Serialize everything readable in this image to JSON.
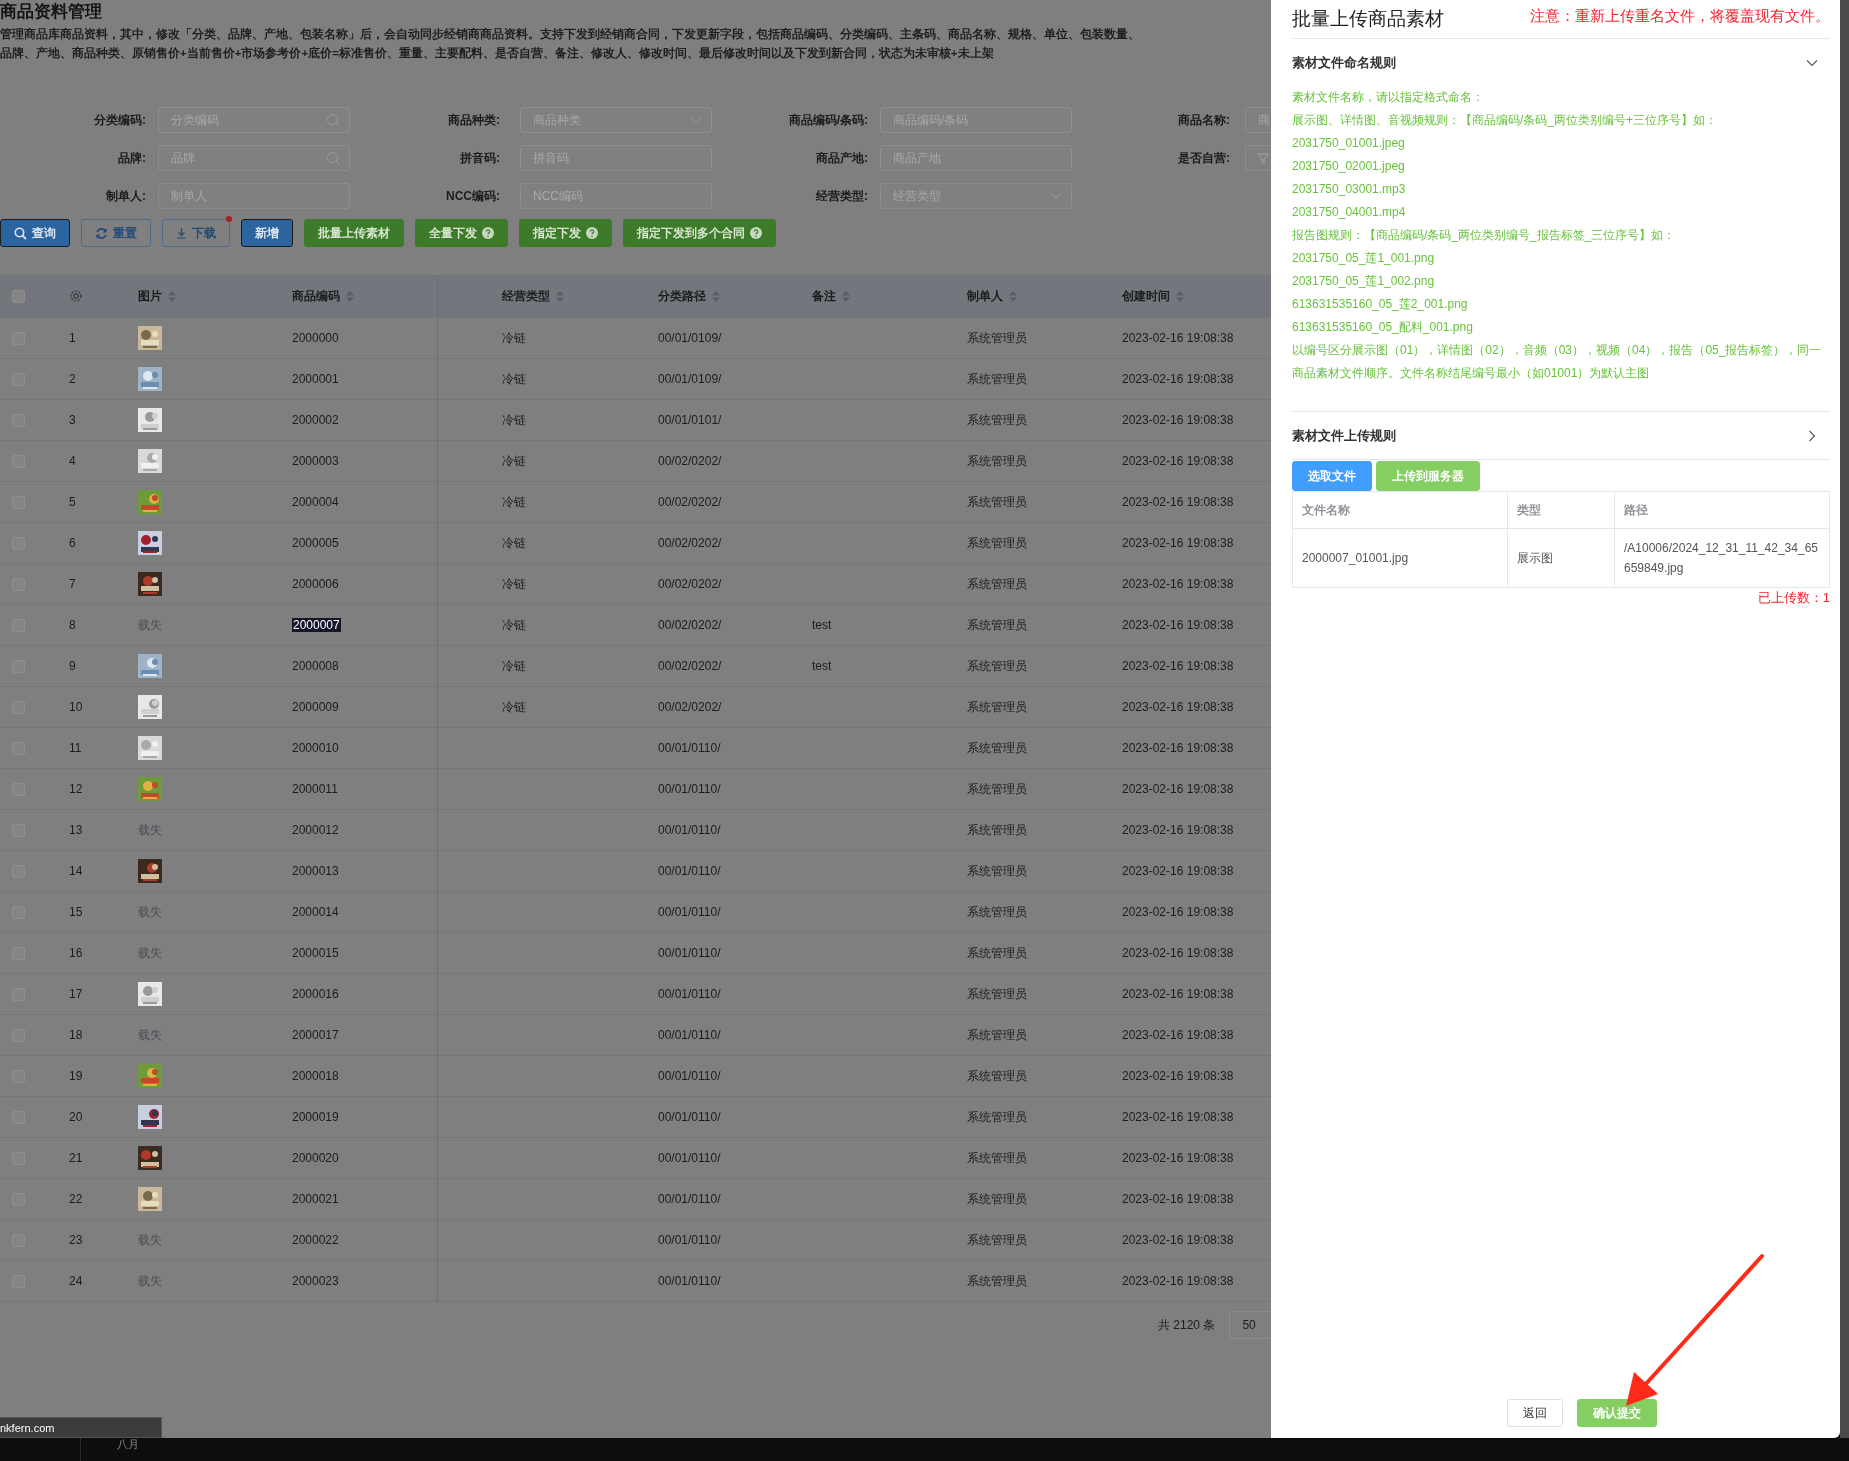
{
  "page": {
    "title": "商品资料管理",
    "description": "管理商品库商品资料，其中，修改「分类、品牌、产地、包装名称」后，会自动同步经销商商品资料。支持下发到经销商合同，下发更新字段，包括商品编码、分类编码、主条码、商品名称、规格、单位、包装数量、品牌、产地、商品种类、原销售价+当前售价+市场参考价+底价=标准售价、重量、主要配料、是否自营、备注、修改人、修改时间、最后修改时间以及下发到新合同，状态为未审核+未上架"
  },
  "filter_rows": [
    [
      {
        "label": "分类编码:",
        "placeholder": "分类编码",
        "kind": "search"
      },
      {
        "label": "商品种类:",
        "placeholder": "商品种类",
        "kind": "select"
      },
      {
        "label": "商品编码/条码:",
        "placeholder": "商品编码/条码",
        "kind": "text"
      },
      {
        "label": "商品名称:",
        "placeholder": "商",
        "kind": "text"
      }
    ],
    [
      {
        "label": "品牌:",
        "placeholder": "品牌",
        "kind": "search"
      },
      {
        "label": "拼音码:",
        "placeholder": "拼音码",
        "kind": "text"
      },
      {
        "label": "商品产地:",
        "placeholder": "商品产地",
        "kind": "text"
      },
      {
        "label": "是否自营:",
        "kind": "icon"
      }
    ],
    [
      {
        "label": "制单人:",
        "placeholder": "制单人",
        "kind": "text"
      },
      {
        "label": "NCC编码:",
        "placeholder": "NCC编码",
        "kind": "text"
      },
      {
        "label": "经营类型:",
        "placeholder": "经营类型",
        "kind": "select"
      }
    ]
  ],
  "actions": [
    {
      "label": "查询",
      "kind": "primary",
      "badge": false
    },
    {
      "label": "重置",
      "kind": "outline",
      "badge": false
    },
    {
      "label": "下载",
      "kind": "outline",
      "badge": true
    },
    {
      "label": "新增",
      "kind": "primary",
      "badge": false
    },
    {
      "label": "批量上传素材",
      "kind": "success",
      "badge": false
    },
    {
      "label": "全量下发",
      "kind": "success",
      "badge": false
    },
    {
      "label": "指定下发",
      "kind": "success",
      "badge": false
    },
    {
      "label": "指定下发到多个合同",
      "kind": "success",
      "badge": false
    }
  ],
  "table": {
    "header_checked": false,
    "columns": [
      {
        "label": "图片"
      },
      {
        "label": "商品编码"
      },
      {
        "label": "经营类型"
      },
      {
        "label": "分类路径"
      },
      {
        "label": "备注"
      },
      {
        "label": "制单人"
      },
      {
        "label": "创建时间"
      }
    ],
    "rows": [
      {
        "checked": false,
        "index": "1",
        "code": "2000000",
        "code_highlighted": false,
        "business_type": "冷链",
        "category_path": "00/01/0109/",
        "creator": "系统管理员",
        "created_at": "2023-02-16 19:08:38"
      },
      {
        "checked": false,
        "index": "2",
        "code": "2000001",
        "code_highlighted": false,
        "business_type": "冷链",
        "category_path": "00/01/0109/",
        "creator": "系统管理员",
        "created_at": "2023-02-16 19:08:38"
      },
      {
        "checked": false,
        "index": "3",
        "code": "2000002",
        "code_highlighted": false,
        "business_type": "冷链",
        "category_path": "00/01/0101/",
        "creator": "系统管理员",
        "created_at": "2023-02-16 19:08:38"
      },
      {
        "checked": false,
        "index": "4",
        "code": "2000003",
        "code_highlighted": false,
        "business_type": "冷链",
        "category_path": "00/02/0202/",
        "creator": "系统管理员",
        "created_at": "2023-02-16 19:08:38"
      },
      {
        "checked": false,
        "index": "5",
        "code": "2000004",
        "code_highlighted": false,
        "business_type": "冷链",
        "category_path": "00/02/0202/",
        "creator": "系统管理员",
        "created_at": "2023-02-16 19:08:38"
      },
      {
        "checked": false,
        "index": "6",
        "code": "2000005",
        "code_highlighted": false,
        "business_type": "冷链",
        "category_path": "00/02/0202/",
        "creator": "系统管理员",
        "created_at": "2023-02-16 19:08:38"
      },
      {
        "checked": false,
        "index": "7",
        "code": "2000006",
        "code_highlighted": false,
        "business_type": "冷链",
        "category_path": "00/02/0202/",
        "creator": "系统管理员",
        "created_at": "2023-02-16 19:08:38"
      },
      {
        "checked": false,
        "index": "8",
        "image": {
          "kind": "broken",
          "alt": "载失"
        },
        "code": "2000007",
        "code_highlighted": true,
        "business_type": "冷链",
        "category_path": "00/02/0202/",
        "remark": "test",
        "creator": "系统管理员",
        "created_at": "2023-02-16 19:08:38"
      },
      {
        "checked": false,
        "index": "9",
        "code": "2000008",
        "code_highlighted": false,
        "business_type": "冷链",
        "category_path": "00/02/0202/",
        "remark": "test",
        "creator": "系统管理员",
        "created_at": "2023-02-16 19:08:38"
      },
      {
        "checked": false,
        "index": "10",
        "code": "2000009",
        "code_highlighted": false,
        "business_type": "冷链",
        "category_path": "00/02/0202/",
        "creator": "系统管理员",
        "created_at": "2023-02-16 19:08:38"
      },
      {
        "checked": false,
        "index": "11",
        "code": "2000010",
        "code_highlighted": false,
        "category_path": "00/01/0110/",
        "creator": "系统管理员",
        "created_at": "2023-02-16 19:08:38"
      },
      {
        "checked": false,
        "index": "12",
        "code": "2000011",
        "code_highlighted": false,
        "category_path": "00/01/0110/",
        "creator": "系统管理员",
        "created_at": "2023-02-16 19:08:38"
      },
      {
        "checked": false,
        "index": "13",
        "image": {
          "kind": "broken",
          "alt": "载失"
        },
        "code": "2000012",
        "code_highlighted": false,
        "category_path": "00/01/0110/",
        "creator": "系统管理员",
        "created_at": "2023-02-16 19:08:38"
      },
      {
        "checked": false,
        "index": "14",
        "code": "2000013",
        "code_highlighted": false,
        "category_path": "00/01/0110/",
        "creator": "系统管理员",
        "created_at": "2023-02-16 19:08:38"
      },
      {
        "checked": false,
        "index": "15",
        "image": {
          "kind": "broken",
          "alt": "载失"
        },
        "code": "2000014",
        "code_highlighted": false,
        "category_path": "00/01/0110/",
        "creator": "系统管理员",
        "created_at": "2023-02-16 19:08:38"
      },
      {
        "checked": false,
        "index": "16",
        "image": {
          "kind": "broken",
          "alt": "载失"
        },
        "code": "2000015",
        "code_highlighted": false,
        "category_path": "00/01/0110/",
        "creator": "系统管理员",
        "created_at": "2023-02-16 19:08:38"
      },
      {
        "checked": false,
        "index": "17",
        "code": "2000016",
        "code_highlighted": false,
        "category_path": "00/01/0110/",
        "creator": "系统管理员",
        "created_at": "2023-02-16 19:08:38"
      },
      {
        "checked": false,
        "index": "18",
        "image": {
          "kind": "broken",
          "alt": "载失"
        },
        "code": "2000017",
        "code_highlighted": false,
        "category_path": "00/01/0110/",
        "creator": "系统管理员",
        "created_at": "2023-02-16 19:08:38"
      },
      {
        "checked": false,
        "index": "19",
        "code": "2000018",
        "code_highlighted": false,
        "category_path": "00/01/0110/",
        "creator": "系统管理员",
        "created_at": "2023-02-16 19:08:38"
      },
      {
        "checked": false,
        "index": "20",
        "code": "2000019",
        "code_highlighted": false,
        "category_path": "00/01/0110/",
        "creator": "系统管理员",
        "created_at": "2023-02-16 19:08:38"
      },
      {
        "checked": false,
        "index": "21",
        "code": "2000020",
        "code_highlighted": false,
        "category_path": "00/01/0110/",
        "creator": "系统管理员",
        "created_at": "2023-02-16 19:08:38"
      },
      {
        "checked": false,
        "index": "22",
        "code": "2000021",
        "code_highlighted": false,
        "category_path": "00/01/0110/",
        "creator": "系统管理员",
        "created_at": "2023-02-16 19:08:38"
      },
      {
        "checked": false,
        "index": "23",
        "image": {
          "kind": "broken",
          "alt": "载失"
        },
        "code": "2000022",
        "code_highlighted": false,
        "category_path": "00/01/0110/",
        "creator": "系统管理员",
        "created_at": "2023-02-16 19:08:38"
      },
      {
        "checked": false,
        "index": "24",
        "image": {
          "kind": "broken",
          "alt": "载失"
        },
        "code": "2000023",
        "code_highlighted": false,
        "category_path": "00/01/0110/",
        "creator": "系统管理员",
        "created_at": "2023-02-16 19:08:38"
      }
    ]
  },
  "pagination": {
    "total": "共 2120 条",
    "page_size": "50"
  },
  "upload_panel": {
    "title": "批量上传商品素材",
    "notice": "注意：重新上传重名文件，将覆盖现有文件。",
    "sections": [
      {
        "title": "素材文件命名规则",
        "expanded": true,
        "lines": [
          "素材文件名称，请以指定格式命名：",
          "展示图、详情图、音视频规则：【商品编码/条码_两位类别编号+三位序号】如：",
          "2031750_01001.jpeg",
          "2031750_02001.jpeg",
          "2031750_03001.mp3",
          "2031750_04001.mp4",
          "报告图规则：【商品编码/条码_两位类别编号_报告标签_三位序号】如：",
          "2031750_05_莲1_001.png",
          "2031750_05_莲1_002.png",
          "613631535160_05_莲2_001.png",
          "613631535160_05_配料_001.png",
          "以编号区分展示图（01），详情图（02），音频（03），视频（04），报告（05_报告标签），同一商品素材文件顺序。文件名称结尾编号最小（如01001）为默认主图"
        ]
      },
      {
        "title": "素材文件上传规则",
        "expanded": false
      }
    ],
    "buttons": [
      {
        "label": "选取文件",
        "kind": "primary"
      },
      {
        "label": "上传到服务器",
        "kind": "success"
      }
    ],
    "files": {
      "columns": [
        "文件名称",
        "类型",
        "路径"
      ],
      "rows": [
        [
          "2000007_01001.jpg",
          "展示图",
          "/A10006/2024_12_31_11_42_34_65659849.jpg"
        ]
      ]
    },
    "uploaded_count": "已上传数：1",
    "footer_buttons": [
      {
        "label": "返回",
        "kind": "default"
      },
      {
        "label": "确认提交",
        "kind": "success"
      }
    ]
  },
  "status_tooltip": "nkfern.com",
  "taskbar": {
    "label": "八月"
  }
}
